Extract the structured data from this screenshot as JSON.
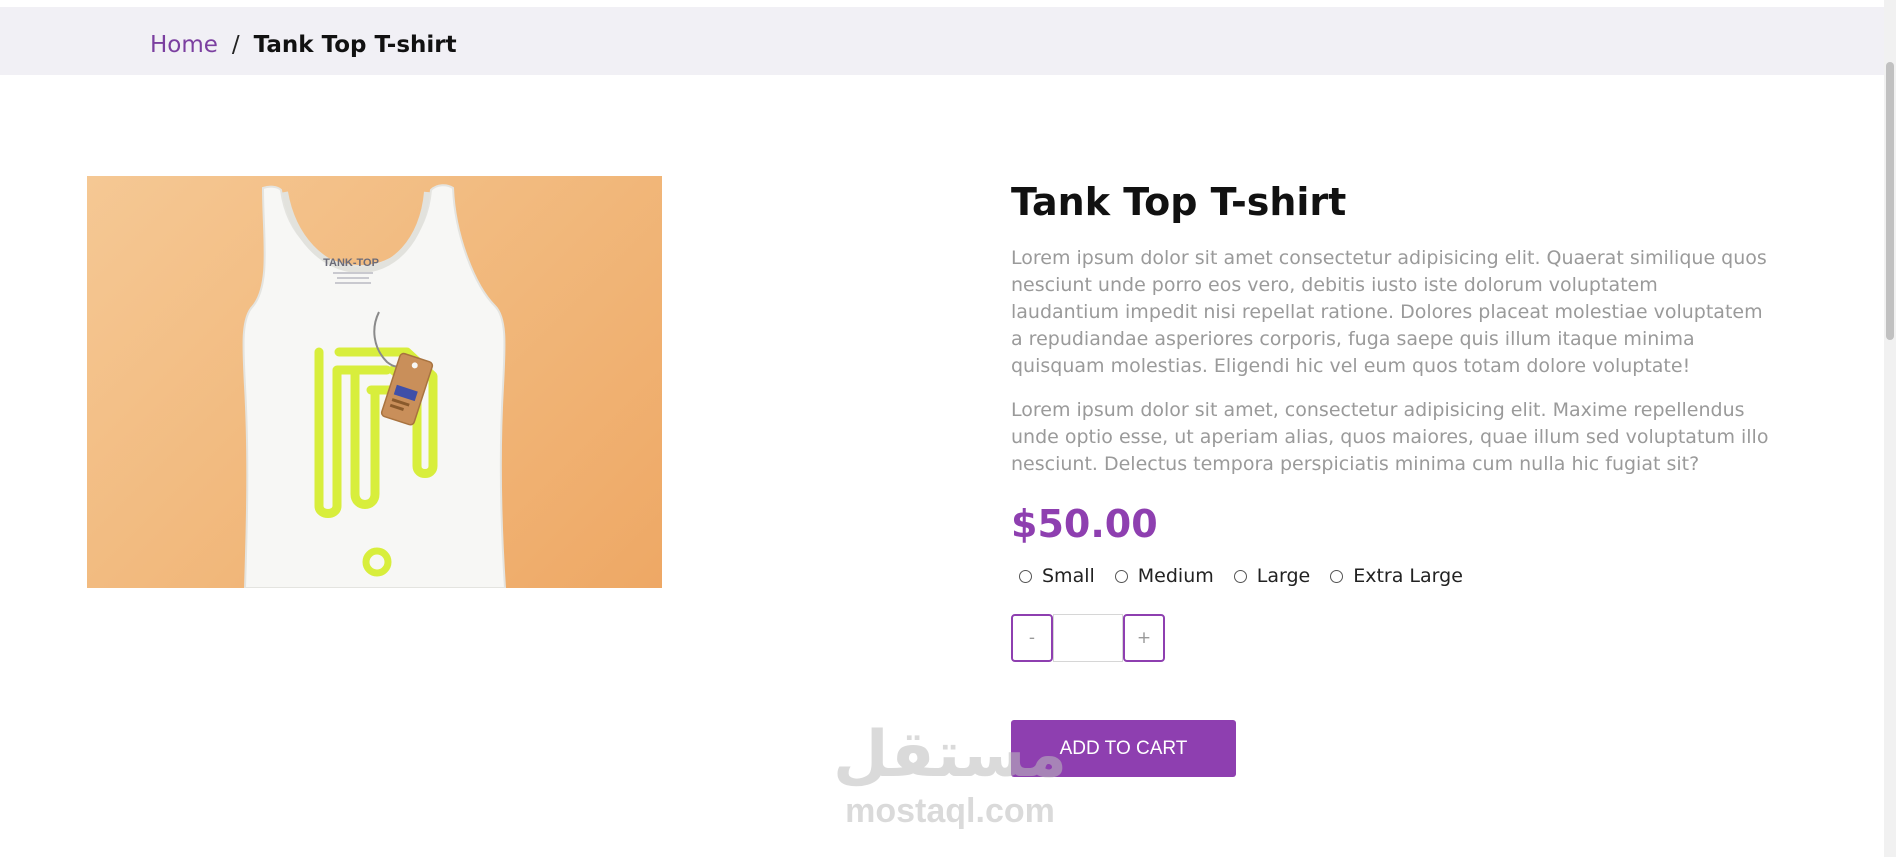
{
  "breadcrumb": {
    "home": "Home",
    "separator": "/",
    "current": "Tank Top T-shirt"
  },
  "product": {
    "title": "Tank Top T-shirt",
    "description_1": "Lorem ipsum dolor sit amet consectetur adipisicing elit. Quaerat similique quos nesciunt unde porro eos vero, debitis iusto iste dolorum voluptatem laudantium impedit nisi repellat ratione. Dolores placeat molestiae voluptatem a repudiandae asperiores corporis, fuga saepe quis illum itaque minima quisquam molestias. Eligendi hic vel eum quos totam dolore voluptate!",
    "description_2": "Lorem ipsum dolor sit amet, consectetur adipisicing elit. Maxime repellendus unde optio esse, ut aperiam alias, quos maiores, quae illum sed voluptatum illo nesciunt. Delectus tempora perspiciatis minima cum nulla hic fugiat sit?",
    "price": "$50.00",
    "sizes": [
      "Small",
      "Medium",
      "Large",
      "Extra Large"
    ],
    "image_tag_text": "TANK-TOP"
  },
  "quantity": {
    "minus_label": "-",
    "plus_label": "+",
    "value": ""
  },
  "cart": {
    "add_label": "ADD TO CART"
  },
  "watermark": {
    "arabic": "مستقل",
    "latin": "mostaql.com"
  },
  "colors": {
    "accent": "#8e3fb0",
    "breadcrumb_bg": "#f1f0f5",
    "image_bg": "#f1b77a",
    "print_lime": "#d8ee3c"
  }
}
